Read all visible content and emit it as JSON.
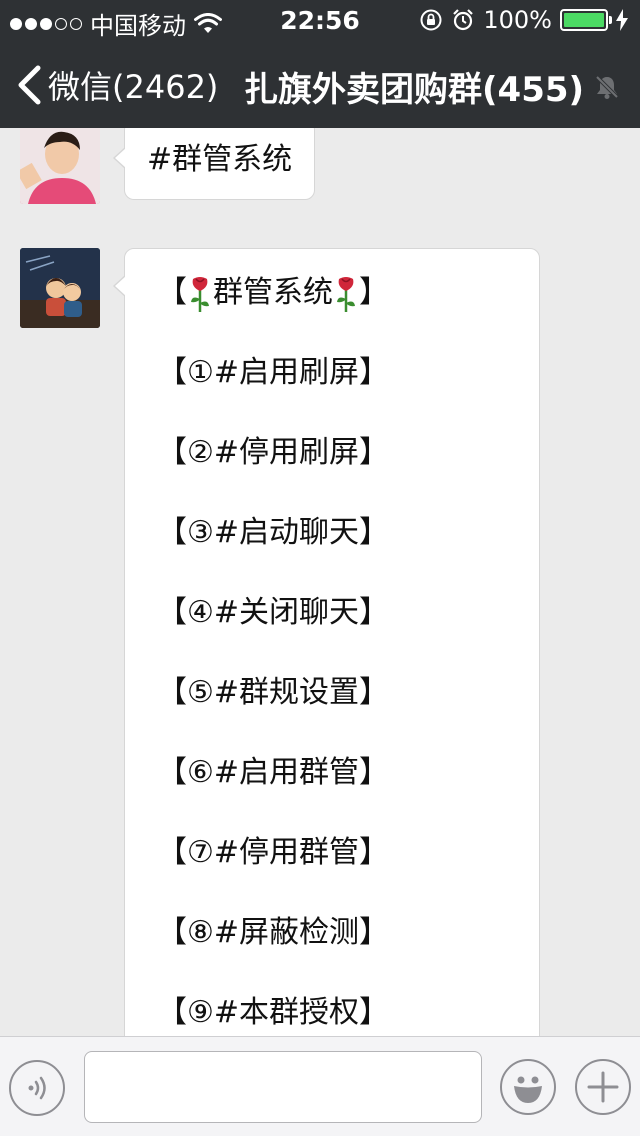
{
  "status_bar": {
    "carrier": "中国移动",
    "time": "22:56",
    "battery_text": "100%",
    "battery_level": 1.0,
    "signal_dots_filled": 3,
    "signal_dots_total": 5
  },
  "nav": {
    "back_label": "微信(2462)",
    "title": "扎旗外卖团购群(455)"
  },
  "messages": [
    {
      "text": "#群管系统"
    },
    {
      "title_left": "【",
      "title_text": "群管系统",
      "title_right": "】",
      "items": [
        "【①#启用刷屏】",
        "【②#停用刷屏】",
        "【③#启动聊天】",
        "【④#关闭聊天】",
        "【⑤#群规设置】",
        "【⑥#启用群管】",
        "【⑦#停用群管】",
        "【⑧#屏蔽检测】",
        "【⑨#本群授权】"
      ]
    }
  ],
  "input": {
    "value": "",
    "placeholder": ""
  },
  "colors": {
    "header_bg": "#2e3134",
    "chat_bg": "#ebebeb",
    "battery_green": "#4cd964",
    "rose_red": "#d0263a",
    "rose_green": "#3a8d2f"
  },
  "icons": {
    "back": "chevron-left-icon",
    "mute": "bell-slash-icon",
    "voice": "voice-icon",
    "emoji": "smiley-icon",
    "plus": "plus-icon"
  }
}
